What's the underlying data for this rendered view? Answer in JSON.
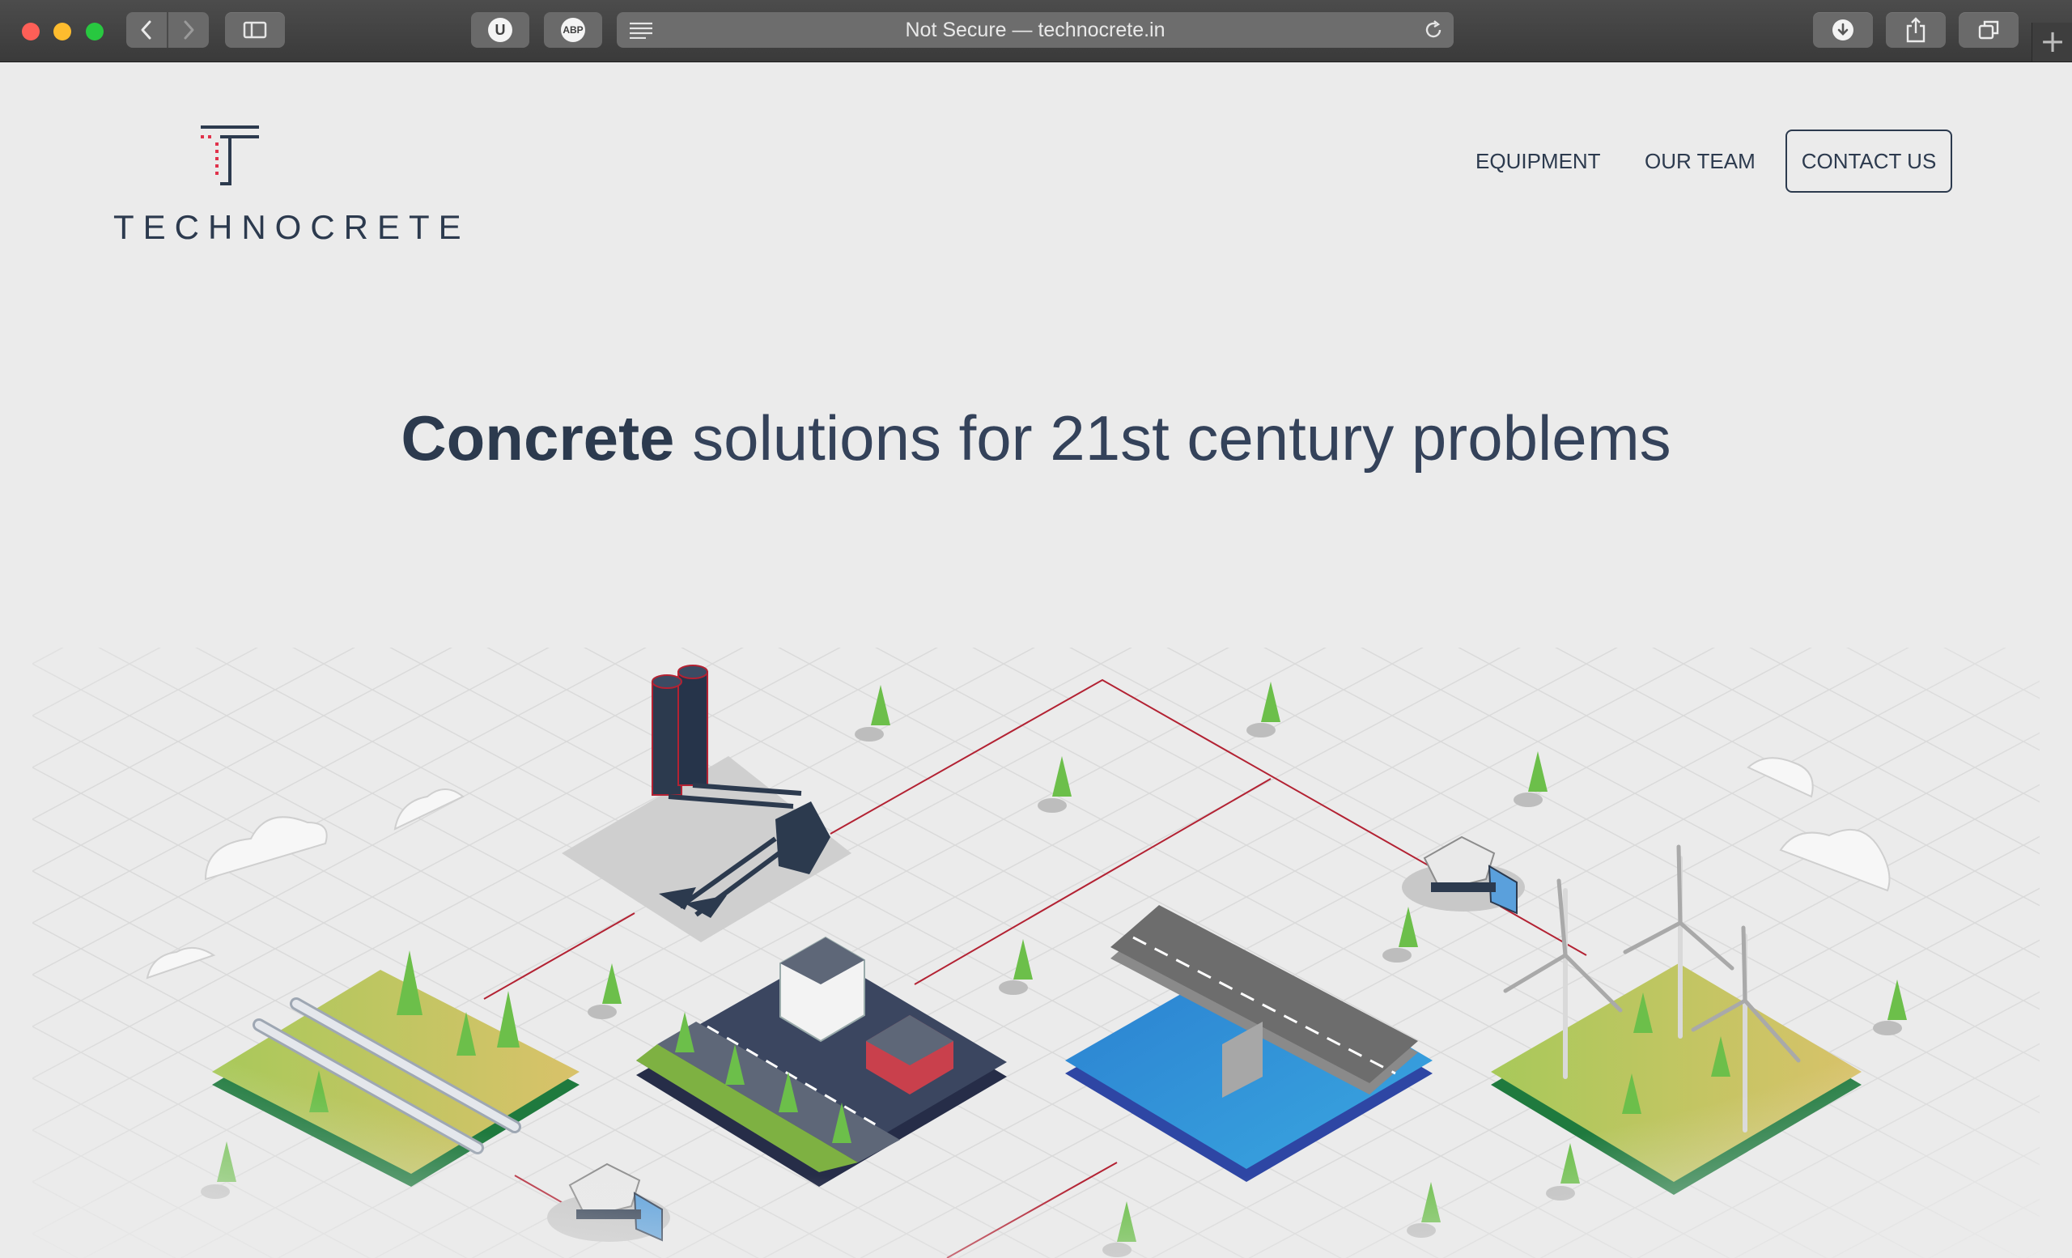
{
  "browser": {
    "url_text": "Not Secure — technocrete.in",
    "extensions": [
      {
        "name": "ublock-origin",
        "badge": "U"
      },
      {
        "name": "adblock-plus",
        "badge": "ABP"
      }
    ]
  },
  "site": {
    "brand": "TECHNOCRETE",
    "nav": {
      "equipment": "EQUIPMENT",
      "team": "OUR TEAM",
      "contact": "CONTACT US"
    },
    "hero": {
      "bold": "Concrete",
      "rest": "solutions for 21st century problems"
    },
    "colors": {
      "navy": "#2c3a4e",
      "accent_red": "#e0324b",
      "line_red": "#b32233",
      "background": "#ebebeb"
    }
  }
}
